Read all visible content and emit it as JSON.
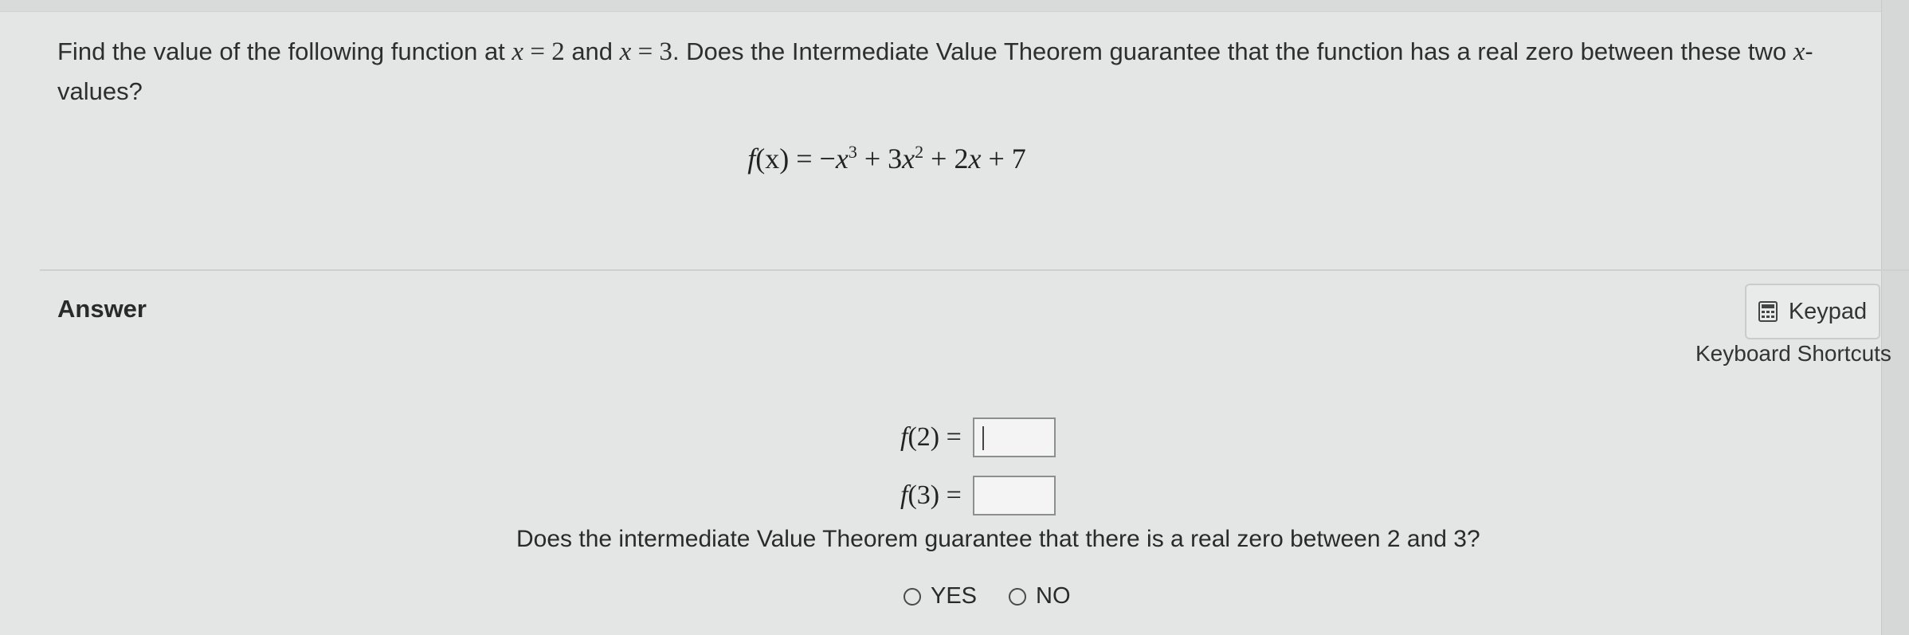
{
  "question": {
    "part1": "Find the value of the following function at ",
    "x_var_a": "x",
    "eq_a": " = 2",
    "part2": " and ",
    "x_var_b": "x",
    "eq_b": " = 3",
    "part3": ". Does the Intermediate Value Theorem guarantee that the function has a real zero between these two ",
    "x_var_c": "x",
    "part4": "-",
    "part5": "values?"
  },
  "equation": {
    "lhs_f": "f",
    "lhs_arg": "(x)",
    "eq": " = −",
    "t1_var": "x",
    "t1_exp": "3",
    "t2": " + 3",
    "t2_var": "x",
    "t2_exp": "2",
    "t3": " + 2",
    "t3_var": "x",
    "t4": " + 7"
  },
  "answer": {
    "label": "Answer",
    "keypad_label": "Keypad",
    "shortcuts_label": "Keyboard Shortcuts",
    "f2_lhs_f": "f",
    "f2_lhs_arg": "(2) =",
    "f2_value": "",
    "f3_lhs_f": "f",
    "f3_lhs_arg": "(3) =",
    "f3_value": "",
    "ivt_question": "Does the intermediate Value Theorem guarantee that there is a real zero between 2 and 3?",
    "choice_yes": "YES",
    "choice_no": "NO"
  },
  "icons": {
    "keypad": "calculator-icon"
  }
}
